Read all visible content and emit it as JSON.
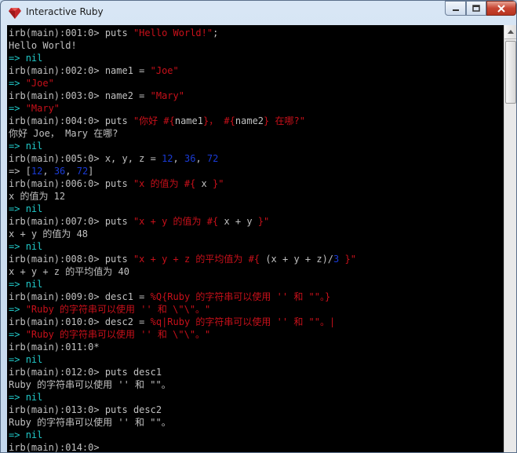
{
  "window": {
    "title": "Interactive Ruby",
    "colors": {
      "prompt_text": "#c0c0c0",
      "string": "#c8101a",
      "keyword": "#21c8c8",
      "number": "#1a3bd6",
      "background": "#000000"
    }
  },
  "console": {
    "lines": [
      [
        {
          "t": "irb(main):001:0> puts ",
          "c": "w"
        },
        {
          "t": "\"Hello World!\"",
          "c": "r"
        },
        {
          "t": ";",
          "c": "w"
        }
      ],
      [
        {
          "t": "Hello World!",
          "c": "w"
        }
      ],
      [
        {
          "t": "=> ",
          "c": "c"
        },
        {
          "t": "nil",
          "c": "c"
        }
      ],
      [
        {
          "t": "irb(main):002:0> name1 = ",
          "c": "w"
        },
        {
          "t": "\"Joe\"",
          "c": "r"
        }
      ],
      [
        {
          "t": "=> ",
          "c": "c"
        },
        {
          "t": "\"Joe\"",
          "c": "r"
        }
      ],
      [
        {
          "t": "irb(main):003:0> name2 = ",
          "c": "w"
        },
        {
          "t": "\"Mary\"",
          "c": "r"
        }
      ],
      [
        {
          "t": "=> ",
          "c": "c"
        },
        {
          "t": "\"Mary\"",
          "c": "r"
        }
      ],
      [
        {
          "t": "irb(main):004:0> puts ",
          "c": "w"
        },
        {
          "t": "\"你好 #{",
          "c": "r"
        },
        {
          "t": "name1",
          "c": "w"
        },
        {
          "t": "}， #{",
          "c": "r"
        },
        {
          "t": "name2",
          "c": "w"
        },
        {
          "t": "} 在哪?\"",
          "c": "r"
        }
      ],
      [
        {
          "t": "你好 Joe， Mary 在哪?",
          "c": "w"
        }
      ],
      [
        {
          "t": "=> ",
          "c": "c"
        },
        {
          "t": "nil",
          "c": "c"
        }
      ],
      [
        {
          "t": "irb(main):005:0> x, y, z = ",
          "c": "w"
        },
        {
          "t": "12",
          "c": "b"
        },
        {
          "t": ", ",
          "c": "w"
        },
        {
          "t": "36",
          "c": "b"
        },
        {
          "t": ", ",
          "c": "w"
        },
        {
          "t": "72",
          "c": "b"
        }
      ],
      [
        {
          "t": "=> [",
          "c": "w"
        },
        {
          "t": "12",
          "c": "b"
        },
        {
          "t": ", ",
          "c": "w"
        },
        {
          "t": "36",
          "c": "b"
        },
        {
          "t": ", ",
          "c": "w"
        },
        {
          "t": "72",
          "c": "b"
        },
        {
          "t": "]",
          "c": "w"
        }
      ],
      [
        {
          "t": "irb(main):006:0> puts ",
          "c": "w"
        },
        {
          "t": "\"x 的值为 #{ ",
          "c": "r"
        },
        {
          "t": "x",
          "c": "w"
        },
        {
          "t": " }\"",
          "c": "r"
        }
      ],
      [
        {
          "t": "x 的值为 12",
          "c": "w"
        }
      ],
      [
        {
          "t": "=> ",
          "c": "c"
        },
        {
          "t": "nil",
          "c": "c"
        }
      ],
      [
        {
          "t": "irb(main):007:0> puts ",
          "c": "w"
        },
        {
          "t": "\"x + y 的值为 #{ ",
          "c": "r"
        },
        {
          "t": "x + y",
          "c": "w"
        },
        {
          "t": " }\"",
          "c": "r"
        }
      ],
      [
        {
          "t": "x + y 的值为 48",
          "c": "w"
        }
      ],
      [
        {
          "t": "=> ",
          "c": "c"
        },
        {
          "t": "nil",
          "c": "c"
        }
      ],
      [
        {
          "t": "irb(main):008:0> puts ",
          "c": "w"
        },
        {
          "t": "\"x + y + z 的平均值为 #{ ",
          "c": "r"
        },
        {
          "t": "(x + y + z)/",
          "c": "w"
        },
        {
          "t": "3",
          "c": "b"
        },
        {
          "t": " }\"",
          "c": "r"
        }
      ],
      [
        {
          "t": "x + y + z 的平均值为 40",
          "c": "w"
        }
      ],
      [
        {
          "t": "=> ",
          "c": "c"
        },
        {
          "t": "nil",
          "c": "c"
        }
      ],
      [
        {
          "t": "irb(main):009:0> desc1 = ",
          "c": "w"
        },
        {
          "t": "%Q{Ruby 的字符串可以使用 '' 和 \"\"。}",
          "c": "r"
        }
      ],
      [
        {
          "t": "=> ",
          "c": "c"
        },
        {
          "t": "\"Ruby 的字符串可以使用 '' 和 \\\"\\\"。\"",
          "c": "r"
        }
      ],
      [
        {
          "t": "irb(main):010:0> desc2 = ",
          "c": "w"
        },
        {
          "t": "%q|Ruby 的字符串可以使用 '' 和 \"\"。|",
          "c": "r"
        }
      ],
      [
        {
          "t": "=> ",
          "c": "c"
        },
        {
          "t": "\"Ruby 的字符串可以使用 '' 和 \\\"\\\"。\"",
          "c": "r"
        }
      ],
      [
        {
          "t": "irb(main):011:0*",
          "c": "w"
        }
      ],
      [
        {
          "t": "=> ",
          "c": "c"
        },
        {
          "t": "nil",
          "c": "c"
        }
      ],
      [
        {
          "t": "irb(main):012:0> puts desc1",
          "c": "w"
        }
      ],
      [
        {
          "t": "Ruby 的字符串可以使用 '' 和 \"\"。",
          "c": "w"
        }
      ],
      [
        {
          "t": "=> ",
          "c": "c"
        },
        {
          "t": "nil",
          "c": "c"
        }
      ],
      [
        {
          "t": "irb(main):013:0> puts desc2",
          "c": "w"
        }
      ],
      [
        {
          "t": "Ruby 的字符串可以使用 '' 和 \"\"。",
          "c": "w"
        }
      ],
      [
        {
          "t": "=> ",
          "c": "c"
        },
        {
          "t": "nil",
          "c": "c"
        }
      ],
      [
        {
          "t": "irb(main):014:0>",
          "c": "w"
        }
      ]
    ]
  }
}
